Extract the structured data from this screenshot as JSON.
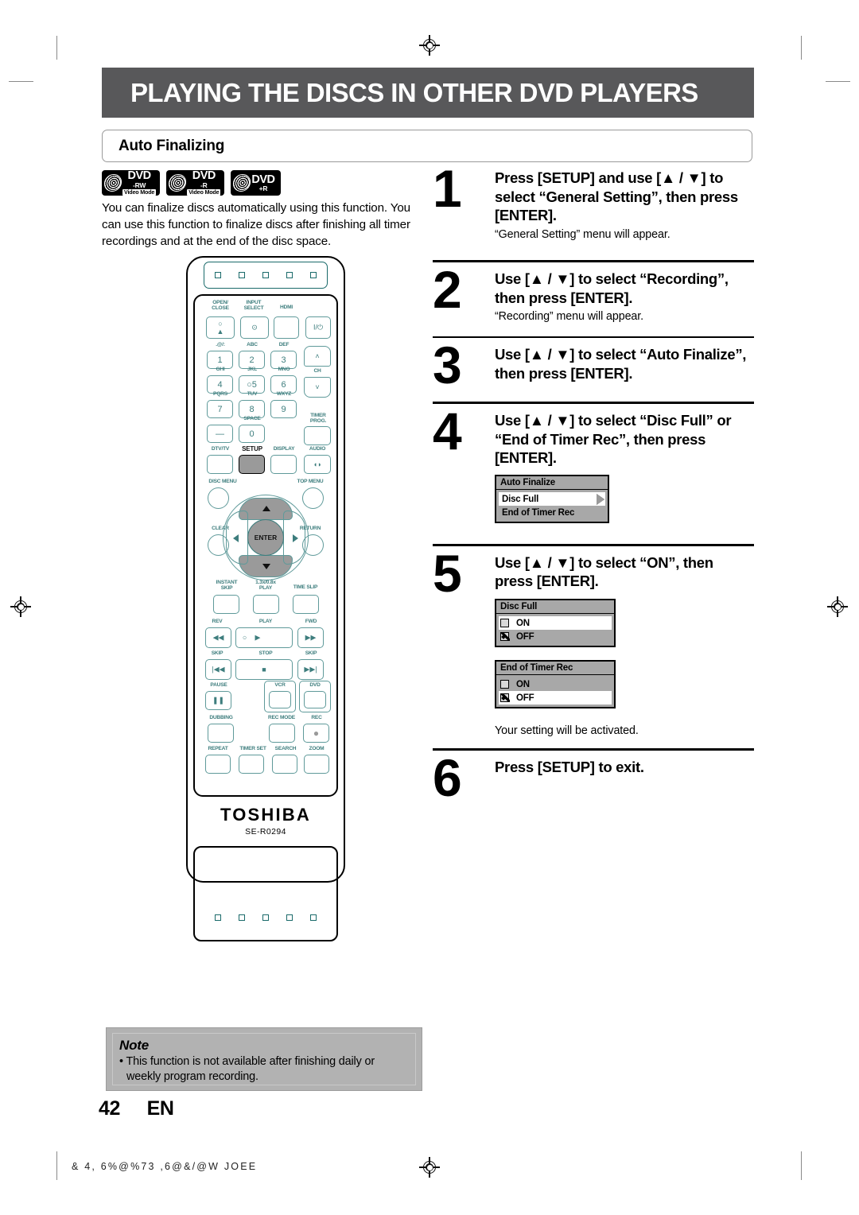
{
  "page": {
    "header_title": "PLAYING THE DISCS IN OTHER DVD PLAYERS",
    "section_title": "Auto Finalizing",
    "page_number": "42",
    "page_language": "EN",
    "footer_code": "& 4, 6%@%73  ,6@&/@W   JOEE"
  },
  "media_logos": [
    {
      "top": "DVD",
      "bottom": "-RW",
      "mode": "Video Mode"
    },
    {
      "top": "DVD",
      "bottom": "-R",
      "mode": "Video Mode"
    },
    {
      "top": "DVD",
      "bottom": "+R",
      "mode": ""
    }
  ],
  "intro": "You can finalize discs automatically using this function. You can use this function to finalize discs after finishing all timer recordings and at the end of the disc space.",
  "steps": [
    {
      "number": "1",
      "heading": "Press [SETUP] and use [▲ / ▼] to select “General Setting”, then press [ENTER].",
      "sub": "“General Setting” menu will appear."
    },
    {
      "number": "2",
      "heading": "Use [▲ / ▼] to select “Recording”, then press [ENTER].",
      "sub": "“Recording” menu will appear."
    },
    {
      "number": "3",
      "heading": "Use [▲ / ▼] to select “Auto Finalize”, then press [ENTER].",
      "sub": ""
    },
    {
      "number": "4",
      "heading": "Use [▲ / ▼] to select “Disc Full” or “End of Timer Rec”, then press [ENTER].",
      "sub": ""
    },
    {
      "number": "5",
      "heading": "Use [▲ / ▼] to select “ON”, then press [ENTER].",
      "sub": ""
    },
    {
      "number": "6",
      "heading": "Press [SETUP] to exit.",
      "sub": ""
    }
  ],
  "osd_menus": {
    "auto_finalize": {
      "title": "Auto Finalize",
      "rows": [
        {
          "label": "Disc Full",
          "selected": true,
          "arrow": true
        },
        {
          "label": "End of Timer Rec",
          "selected": false,
          "arrow": false
        }
      ]
    },
    "disc_full": {
      "title": "Disc Full",
      "rows": [
        {
          "label": "ON",
          "selected": true,
          "checked": false
        },
        {
          "label": "OFF",
          "selected": false,
          "checked": true
        }
      ]
    },
    "end_of_timer_rec": {
      "title": "End of Timer Rec",
      "rows": [
        {
          "label": "ON",
          "selected": false,
          "checked": false
        },
        {
          "label": "OFF",
          "selected": true,
          "checked": true
        }
      ]
    },
    "activated_note": "Your setting will be activated."
  },
  "note": {
    "title": "Note",
    "body": "• This function is not available after finishing daily or weekly program recording."
  },
  "remote": {
    "brand": "TOSHIBA",
    "model": "SE-R0294",
    "buttons": {
      "open_close": "OPEN/\nCLOSE",
      "input_select": "INPUT\nSELECT",
      "hdmi": "HDMI",
      "power": "I/⏻",
      "k1_alpha": ".@/:",
      "k2_alpha": "ABC",
      "k3_alpha": "DEF",
      "k4_alpha": "GHI",
      "k5_alpha": "JKL",
      "k6_alpha": "MNO",
      "k7_alpha": "PQRS",
      "k8_alpha": "TUV",
      "k9_alpha": "WXYZ",
      "k0_alpha": "SPACE",
      "n1": "1",
      "n2": "2",
      "n3": "3",
      "n4": "4",
      "n5": "5",
      "n6": "6",
      "n7": "7",
      "n8": "8",
      "n9": "9",
      "n0": "0",
      "dash": "—",
      "ch": "CH",
      "timer_prog": "TIMER\nPROG.",
      "dtv_tv": "DTV/TV",
      "setup": "SETUP",
      "display": "DISPLAY",
      "audio": "AUDIO",
      "disc_menu": "DISC MENU",
      "top_menu": "TOP MENU",
      "clear": "CLEAR",
      "return": "RETURN",
      "enter": "ENTER",
      "instant_skip": "INSTANT\nSKIP",
      "play_speed": "1.3x/0.8x\nPLAY",
      "time_slip": "TIME SLIP",
      "rev": "REV",
      "play": "PLAY",
      "fwd": "FWD",
      "skip_back": "SKIP",
      "stop": "STOP",
      "skip_fwd": "SKIP",
      "pause": "PAUSE",
      "vcr": "VCR",
      "dvd": "DVD",
      "dubbing": "DUBBING",
      "rec_mode": "REC MODE",
      "rec": "REC",
      "repeat": "REPEAT",
      "timer_set": "TIMER SET",
      "search": "SEARCH",
      "zoom": "ZOOM"
    }
  }
}
